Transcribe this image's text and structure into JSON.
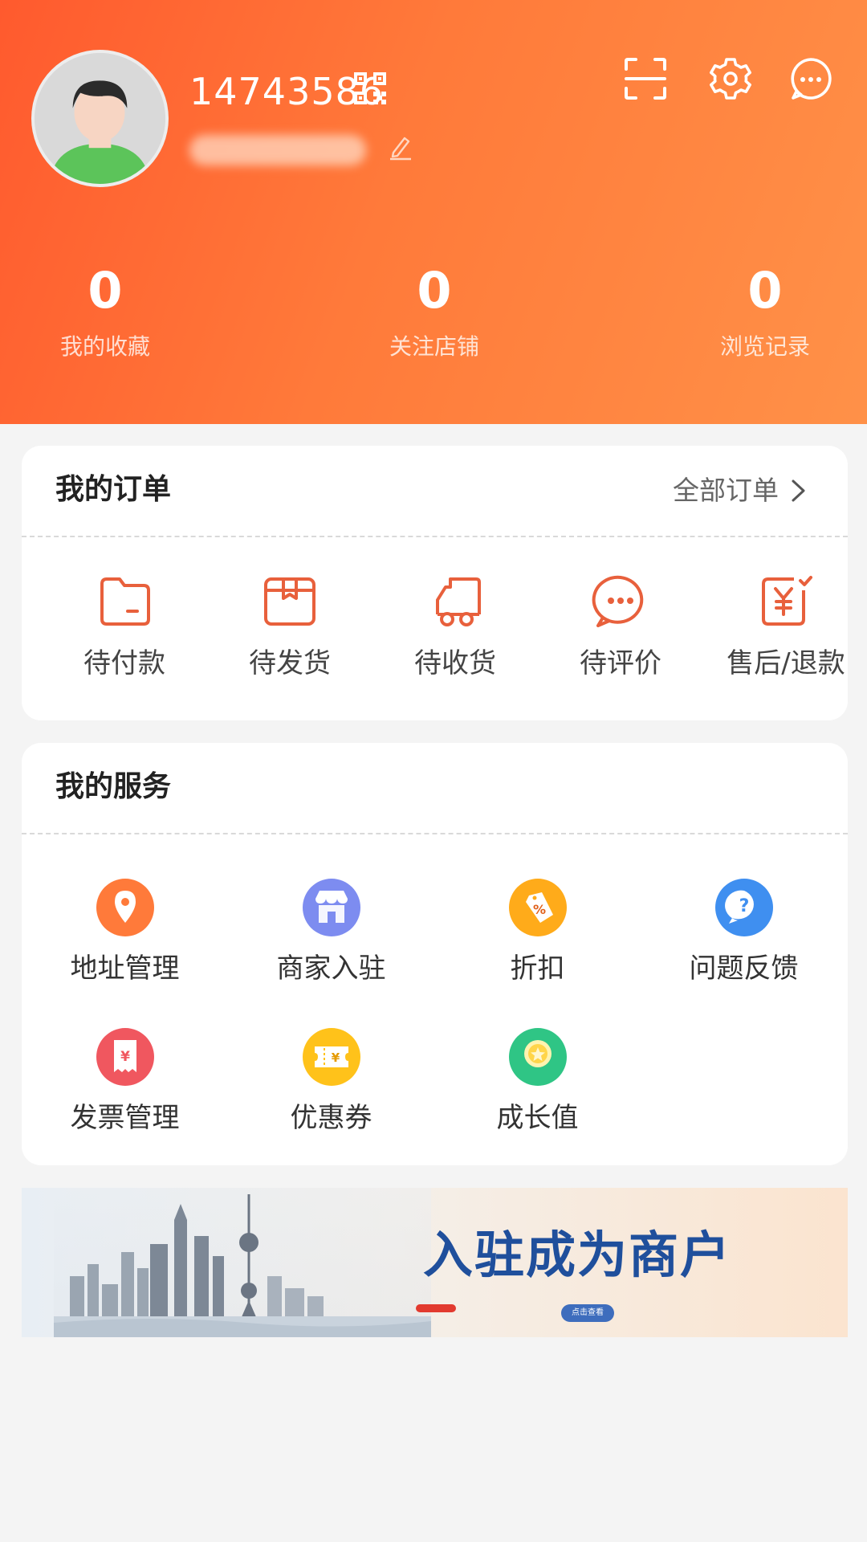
{
  "profile": {
    "user_id": "14743586"
  },
  "stats": [
    {
      "value": "0",
      "label": "我的收藏"
    },
    {
      "value": "0",
      "label": "关注店铺"
    },
    {
      "value": "0",
      "label": "浏览记录"
    }
  ],
  "orders": {
    "title": "我的订单",
    "all_label": "全部订单",
    "items": [
      {
        "label": "待付款",
        "icon": "wallet-icon"
      },
      {
        "label": "待发货",
        "icon": "box-icon"
      },
      {
        "label": "待收货",
        "icon": "truck-icon"
      },
      {
        "label": "待评价",
        "icon": "chat-icon"
      },
      {
        "label": "售后/退款",
        "icon": "refund-icon"
      }
    ]
  },
  "services": {
    "title": "我的服务",
    "items": [
      {
        "label": "地址管理",
        "icon": "location-icon",
        "color": "#ff7a3a"
      },
      {
        "label": "商家入驻",
        "icon": "store-icon",
        "color": "#7d8cf0"
      },
      {
        "label": "折扣",
        "icon": "discount-icon",
        "color": "#ffab1a"
      },
      {
        "label": "问题反馈",
        "icon": "question-icon",
        "color": "#3f8ff0"
      },
      {
        "label": "发票管理",
        "icon": "invoice-icon",
        "color": "#f0575f"
      },
      {
        "label": "优惠券",
        "icon": "coupon-icon",
        "color": "#ffc21a"
      },
      {
        "label": "成长值",
        "icon": "growth-icon",
        "color": "#2fc585"
      }
    ]
  },
  "banner": {
    "title": "入驻成为商户",
    "button_label": "点击查看"
  },
  "colors": {
    "header_start": "#ff5a2e",
    "header_end": "#ff9148",
    "order_icon": "#e8603c"
  }
}
